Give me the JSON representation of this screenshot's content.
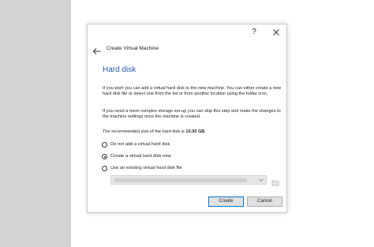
{
  "dialog": {
    "help_label": "?",
    "title": "Create Virtual Machine",
    "section_title": "Hard disk",
    "paragraph_1": "If you wish you can add a virtual hard disk to the new machine. You can either create a new hard disk file or select one from the list or from another location using the folder icon.",
    "paragraph_2": "If you need a more complex storage set-up you can skip this step and make the changes to the machine settings once the machine is created.",
    "recommended_prefix": "The recommended size of the hard disk is ",
    "recommended_size": "10.00 GB",
    "recommended_suffix": ".",
    "options": [
      {
        "label": "Do not add a virtual hard disk",
        "checked": false
      },
      {
        "label": "Create a virtual hard disk now",
        "checked": true
      },
      {
        "label": "Use an existing virtual hard disk file",
        "checked": false
      }
    ],
    "buttons": {
      "create": "Create",
      "cancel": "Cancel"
    }
  },
  "colors": {
    "section_title": "#2a5caa",
    "side_panel": "#d3d3d3",
    "focus_border": "#0078d7"
  },
  "icons": {
    "close": "close-icon",
    "back": "back-arrow-icon",
    "dropdown": "chevron-down-icon",
    "folder": "folder-icon"
  }
}
